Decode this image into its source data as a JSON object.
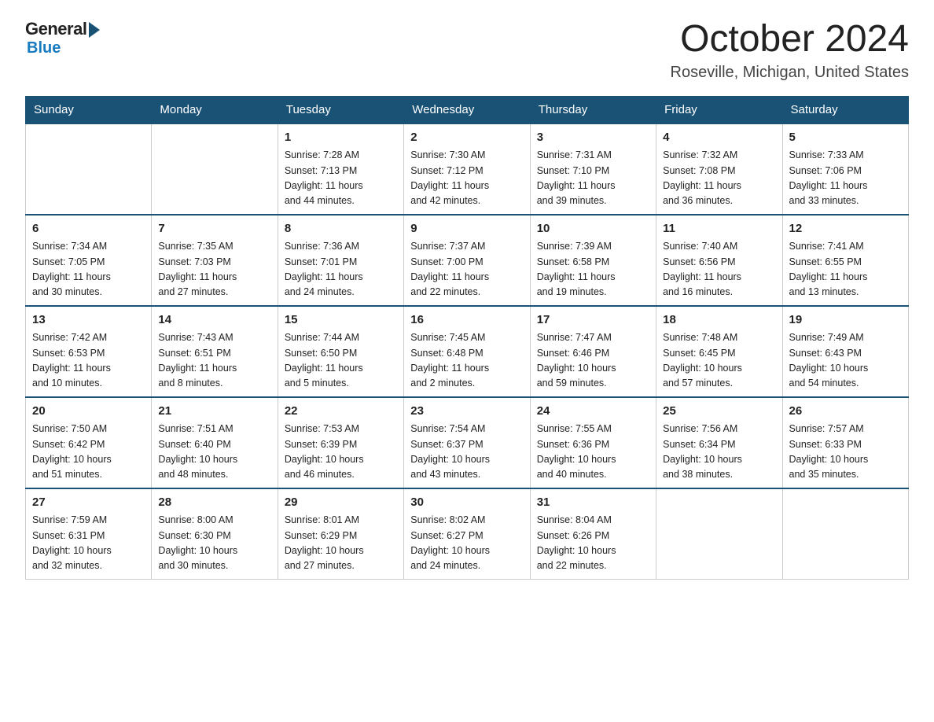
{
  "header": {
    "logo_general": "General",
    "logo_blue": "Blue",
    "month_title": "October 2024",
    "location": "Roseville, Michigan, United States"
  },
  "weekdays": [
    "Sunday",
    "Monday",
    "Tuesday",
    "Wednesday",
    "Thursday",
    "Friday",
    "Saturday"
  ],
  "weeks": [
    [
      {
        "day": "",
        "info": ""
      },
      {
        "day": "",
        "info": ""
      },
      {
        "day": "1",
        "info": "Sunrise: 7:28 AM\nSunset: 7:13 PM\nDaylight: 11 hours\nand 44 minutes."
      },
      {
        "day": "2",
        "info": "Sunrise: 7:30 AM\nSunset: 7:12 PM\nDaylight: 11 hours\nand 42 minutes."
      },
      {
        "day": "3",
        "info": "Sunrise: 7:31 AM\nSunset: 7:10 PM\nDaylight: 11 hours\nand 39 minutes."
      },
      {
        "day": "4",
        "info": "Sunrise: 7:32 AM\nSunset: 7:08 PM\nDaylight: 11 hours\nand 36 minutes."
      },
      {
        "day": "5",
        "info": "Sunrise: 7:33 AM\nSunset: 7:06 PM\nDaylight: 11 hours\nand 33 minutes."
      }
    ],
    [
      {
        "day": "6",
        "info": "Sunrise: 7:34 AM\nSunset: 7:05 PM\nDaylight: 11 hours\nand 30 minutes."
      },
      {
        "day": "7",
        "info": "Sunrise: 7:35 AM\nSunset: 7:03 PM\nDaylight: 11 hours\nand 27 minutes."
      },
      {
        "day": "8",
        "info": "Sunrise: 7:36 AM\nSunset: 7:01 PM\nDaylight: 11 hours\nand 24 minutes."
      },
      {
        "day": "9",
        "info": "Sunrise: 7:37 AM\nSunset: 7:00 PM\nDaylight: 11 hours\nand 22 minutes."
      },
      {
        "day": "10",
        "info": "Sunrise: 7:39 AM\nSunset: 6:58 PM\nDaylight: 11 hours\nand 19 minutes."
      },
      {
        "day": "11",
        "info": "Sunrise: 7:40 AM\nSunset: 6:56 PM\nDaylight: 11 hours\nand 16 minutes."
      },
      {
        "day": "12",
        "info": "Sunrise: 7:41 AM\nSunset: 6:55 PM\nDaylight: 11 hours\nand 13 minutes."
      }
    ],
    [
      {
        "day": "13",
        "info": "Sunrise: 7:42 AM\nSunset: 6:53 PM\nDaylight: 11 hours\nand 10 minutes."
      },
      {
        "day": "14",
        "info": "Sunrise: 7:43 AM\nSunset: 6:51 PM\nDaylight: 11 hours\nand 8 minutes."
      },
      {
        "day": "15",
        "info": "Sunrise: 7:44 AM\nSunset: 6:50 PM\nDaylight: 11 hours\nand 5 minutes."
      },
      {
        "day": "16",
        "info": "Sunrise: 7:45 AM\nSunset: 6:48 PM\nDaylight: 11 hours\nand 2 minutes."
      },
      {
        "day": "17",
        "info": "Sunrise: 7:47 AM\nSunset: 6:46 PM\nDaylight: 10 hours\nand 59 minutes."
      },
      {
        "day": "18",
        "info": "Sunrise: 7:48 AM\nSunset: 6:45 PM\nDaylight: 10 hours\nand 57 minutes."
      },
      {
        "day": "19",
        "info": "Sunrise: 7:49 AM\nSunset: 6:43 PM\nDaylight: 10 hours\nand 54 minutes."
      }
    ],
    [
      {
        "day": "20",
        "info": "Sunrise: 7:50 AM\nSunset: 6:42 PM\nDaylight: 10 hours\nand 51 minutes."
      },
      {
        "day": "21",
        "info": "Sunrise: 7:51 AM\nSunset: 6:40 PM\nDaylight: 10 hours\nand 48 minutes."
      },
      {
        "day": "22",
        "info": "Sunrise: 7:53 AM\nSunset: 6:39 PM\nDaylight: 10 hours\nand 46 minutes."
      },
      {
        "day": "23",
        "info": "Sunrise: 7:54 AM\nSunset: 6:37 PM\nDaylight: 10 hours\nand 43 minutes."
      },
      {
        "day": "24",
        "info": "Sunrise: 7:55 AM\nSunset: 6:36 PM\nDaylight: 10 hours\nand 40 minutes."
      },
      {
        "day": "25",
        "info": "Sunrise: 7:56 AM\nSunset: 6:34 PM\nDaylight: 10 hours\nand 38 minutes."
      },
      {
        "day": "26",
        "info": "Sunrise: 7:57 AM\nSunset: 6:33 PM\nDaylight: 10 hours\nand 35 minutes."
      }
    ],
    [
      {
        "day": "27",
        "info": "Sunrise: 7:59 AM\nSunset: 6:31 PM\nDaylight: 10 hours\nand 32 minutes."
      },
      {
        "day": "28",
        "info": "Sunrise: 8:00 AM\nSunset: 6:30 PM\nDaylight: 10 hours\nand 30 minutes."
      },
      {
        "day": "29",
        "info": "Sunrise: 8:01 AM\nSunset: 6:29 PM\nDaylight: 10 hours\nand 27 minutes."
      },
      {
        "day": "30",
        "info": "Sunrise: 8:02 AM\nSunset: 6:27 PM\nDaylight: 10 hours\nand 24 minutes."
      },
      {
        "day": "31",
        "info": "Sunrise: 8:04 AM\nSunset: 6:26 PM\nDaylight: 10 hours\nand 22 minutes."
      },
      {
        "day": "",
        "info": ""
      },
      {
        "day": "",
        "info": ""
      }
    ]
  ]
}
